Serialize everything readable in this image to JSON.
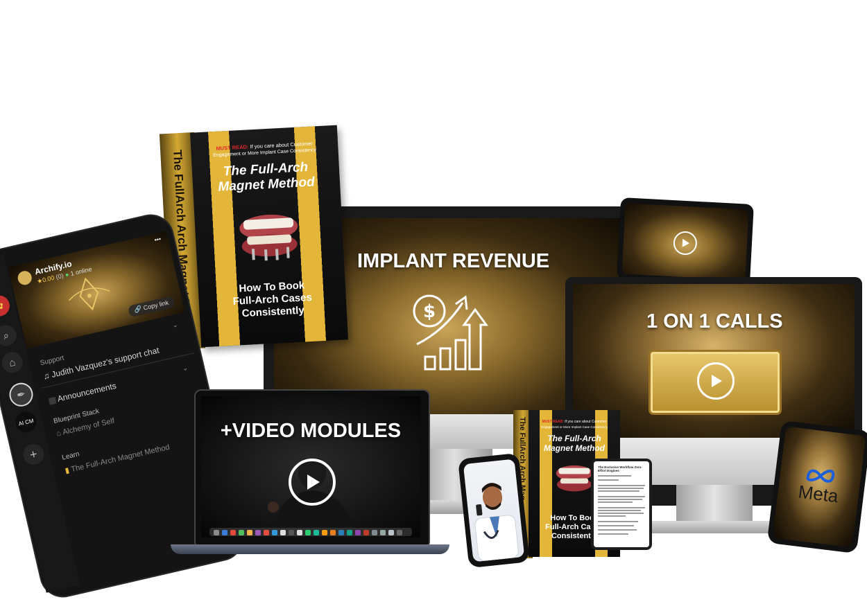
{
  "monitor": {
    "headline": "IMPLANT REVENUE"
  },
  "monitor2": {
    "headline": "1 ON 1 CALLS"
  },
  "laptop": {
    "headline": "+VIDEO MODULES"
  },
  "tablet_meta": {
    "brand": "Meta"
  },
  "ebook": {
    "kicker_highlight": "MUST READ:",
    "kicker_rest": "If you care about Customer",
    "kicker_line2": "Engagement or More Implant Case Consistency",
    "title_line1": "The Full-Arch",
    "title_line2": "Magnet Method",
    "subtitle_line1": "How To Book",
    "subtitle_line2": "Full-Arch Cases",
    "subtitle_line3": "Consistently",
    "spine": "The FullArch Arch Magnet Method"
  },
  "ebook_small": {
    "kicker_highlight": "MUST READ:",
    "kicker_rest": "If you care about Customer",
    "kicker_line2": "Engagement or More Implant Case Consistency",
    "title_line1": "The Full-Arch",
    "title_line2": "Magnet Method",
    "subtitle_line1": "How To Book",
    "subtitle_line2": "Full-Arch Cases",
    "subtitle_line3": "Consistently",
    "spine": "The FullArch Arch Mag"
  },
  "app": {
    "community_name": "Archify.io",
    "rating": "0.00",
    "rating_count": "(0)",
    "online_status": "1 online",
    "copy_link": "Copy link",
    "support_label": "Support",
    "support_chat": "Judith Vazquez's support chat",
    "announcements": "Announcements",
    "blueprint_label": "Blueprint Stack",
    "blueprint_item": "Alchemy of Self",
    "learn_label": "Learn",
    "learn_item": "The Full-Arch Magnet Method",
    "menu_dots": "•••",
    "sidebar_badge": "AI CM",
    "add_symbol": "+"
  },
  "doc_tablet": {
    "title": "The Exclusive Workflow Zero-Effort Engines"
  },
  "colors": {
    "gold": "#e3b63a",
    "dark": "#0d0d0d",
    "must_read_red": "#e02a2a"
  }
}
